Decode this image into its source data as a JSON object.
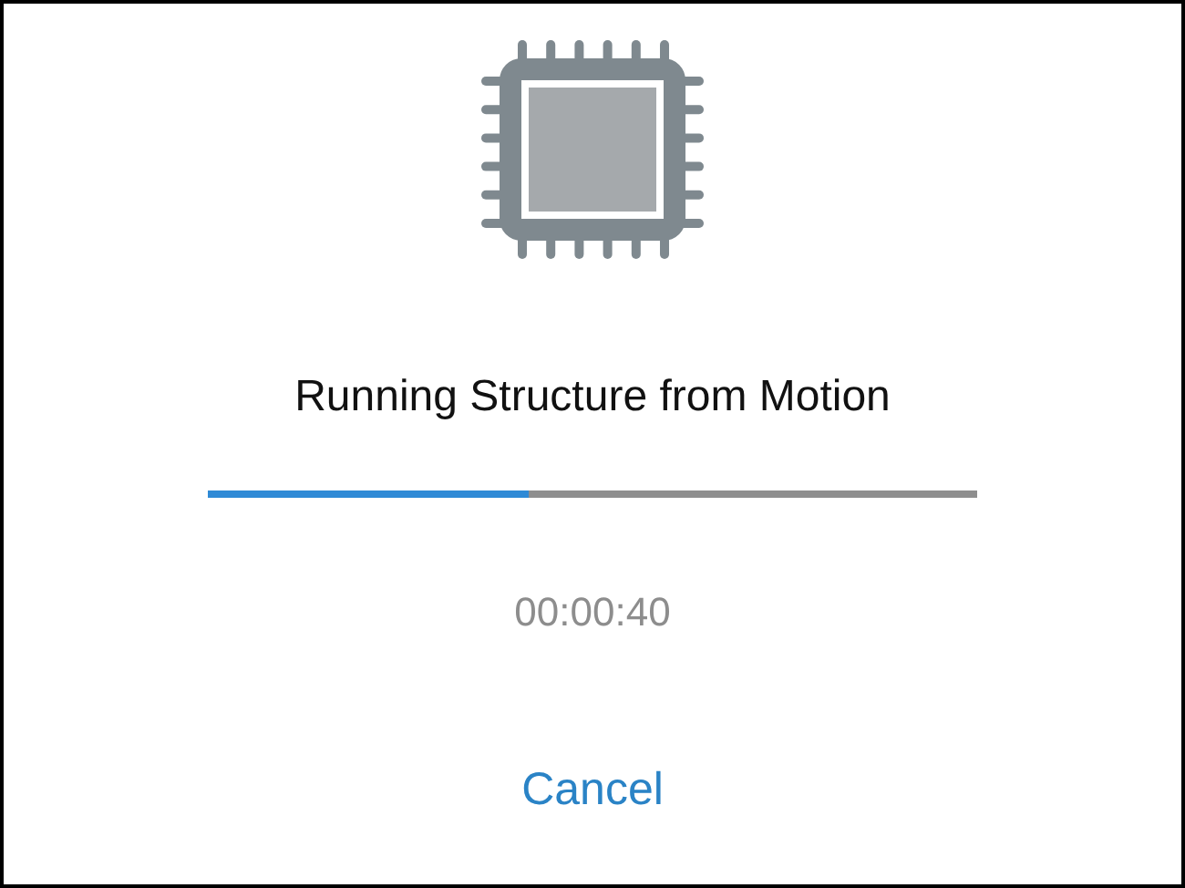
{
  "title": "Running Structure from Motion",
  "progress": {
    "level": 0.417
  },
  "elapsed": "00:00:40",
  "buttons": [
    {
      "label": "Cancel"
    }
  ]
}
